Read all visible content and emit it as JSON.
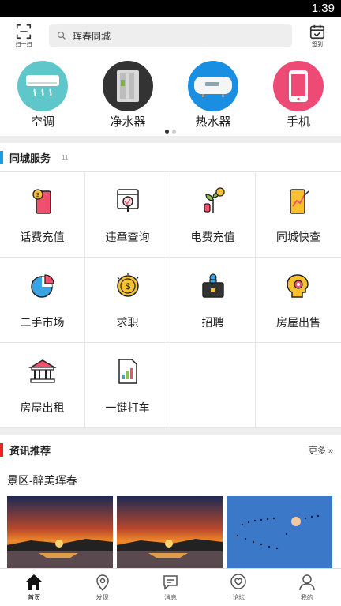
{
  "status_bar": {
    "time": "1:39"
  },
  "top_bar": {
    "scan_label": "扫一扫",
    "search_value": "珲春同城",
    "checkin_label": "签到"
  },
  "categories": [
    {
      "label": "空调",
      "icon": "air-conditioner-icon",
      "bg": "#5fc6c9"
    },
    {
      "label": "净水器",
      "icon": "water-purifier-icon",
      "bg": "#333333"
    },
    {
      "label": "热水器",
      "icon": "water-heater-icon",
      "bg": "#1a8ee0"
    },
    {
      "label": "手机",
      "icon": "mobile-phone-icon",
      "bg": "#ee4a76"
    }
  ],
  "services": {
    "title": "同城服务",
    "count": "11",
    "accent": "#1a9be6",
    "items": [
      {
        "label": "话费充值",
        "icon": "phone-recharge-icon"
      },
      {
        "label": "违章查询",
        "icon": "traffic-violation-icon"
      },
      {
        "label": "电费充值",
        "icon": "electricity-recharge-icon"
      },
      {
        "label": "同城快查",
        "icon": "quick-search-icon"
      },
      {
        "label": "二手市场",
        "icon": "pie-chart-icon"
      },
      {
        "label": "求职",
        "icon": "coin-icon"
      },
      {
        "label": "招聘",
        "icon": "briefcase-icon"
      },
      {
        "label": "房屋出售",
        "icon": "head-gear-icon"
      },
      {
        "label": "房屋出租",
        "icon": "bank-building-icon"
      },
      {
        "label": "一键打车",
        "icon": "document-chart-icon"
      }
    ]
  },
  "news": {
    "title": "资讯推荐",
    "more": "更多",
    "accent": "#ee2222",
    "subtitle": "景区-醉美珲春"
  },
  "tabs": [
    {
      "label": "首页",
      "icon": "home-icon",
      "active": true
    },
    {
      "label": "发现",
      "icon": "location-pin-icon",
      "active": false
    },
    {
      "label": "消息",
      "icon": "chat-bubble-icon",
      "active": false
    },
    {
      "label": "论坛",
      "icon": "heart-chat-icon",
      "active": false
    },
    {
      "label": "我的",
      "icon": "user-icon",
      "active": false
    }
  ]
}
